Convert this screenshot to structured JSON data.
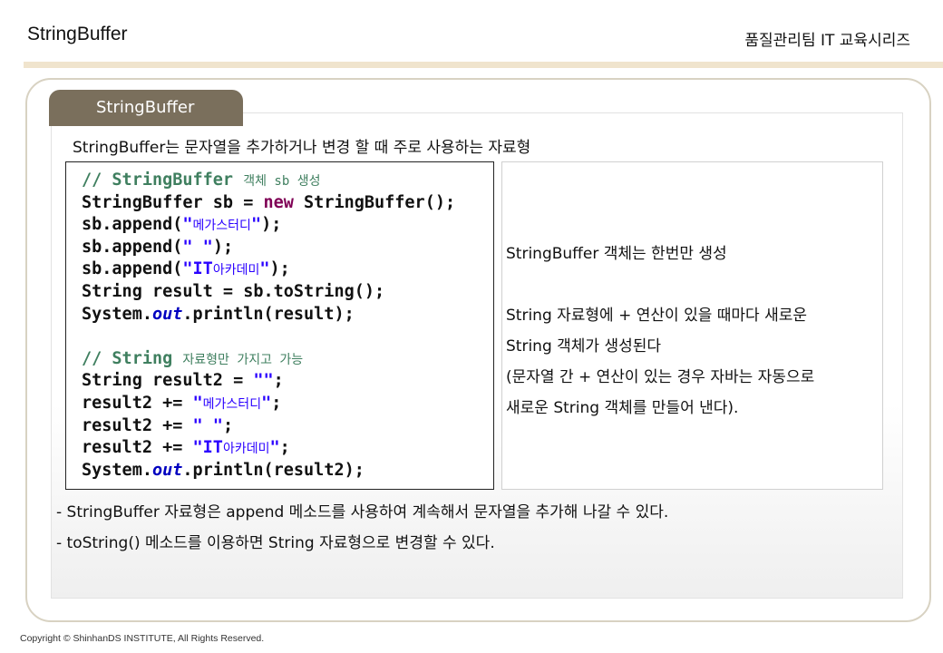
{
  "header": {
    "title": "StringBuffer",
    "series": "품질관리팀 IT 교육시리즈"
  },
  "section": {
    "tab_label": "StringBuffer",
    "intro": "StringBuffer는 문자열을 추가하거나 변경 할 때 주로 사용하는 자료형"
  },
  "code": {
    "comment1_en": "// StringBuffer ",
    "comment1_ko": "객체 sb 생성",
    "l2_type": "StringBuffer sb = ",
    "l2_kw": "new",
    "l2_rest": " StringBuffer();",
    "l3_pre": "sb.append(",
    "l3_q1": "\"",
    "l3_str": "메가스터디",
    "l3_q2": "\"",
    "l3_post": ");",
    "l4_pre": "sb.append(",
    "l4_str": "\" \"",
    "l4_post": ");",
    "l5_pre": "sb.append(",
    "l5_str_en": "\"IT",
    "l5_str_ko": "아카데미",
    "l5_q": "\"",
    "l5_post": ");",
    "l6": "String result = sb.toString();",
    "l7_pre": "System.",
    "l7_field": "out",
    "l7_post": ".println(result);",
    "comment2_en": "// String ",
    "comment2_ko": "자료형만 가지고 가능",
    "l9_pre": "String result2 = ",
    "l9_str": "\"\"",
    "l9_post": ";",
    "l10_pre": "result2 += ",
    "l10_q1": "\"",
    "l10_str": "메가스터디",
    "l10_q2": "\"",
    "l10_post": ";",
    "l11_pre": "result2 += ",
    "l11_str": "\" \"",
    "l11_post": ";",
    "l12_pre": "result2 += ",
    "l12_str_en": "\"IT",
    "l12_str_ko": "아카데미",
    "l12_q": "\"",
    "l12_post": ";",
    "l13_pre": "System.",
    "l13_field": "out",
    "l13_post": ".println(result2);"
  },
  "explain": {
    "line1": "StringBuffer 객체는 한번만 생성",
    "line2": "String 자료형에 + 연산이 있을 때마다 새로운",
    "line3": "String 객체가 생성된다",
    "line4": "(문자열 간 + 연산이 있는 경우 자바는 자동으로",
    "line5": "새로운 String 객체를 만들어 낸다)."
  },
  "bullets": [
    "- StringBuffer 자료형은 append 메소드를 사용하여 계속해서 문자열을 추가해 나갈 수 있다.",
    "- toString() 메소드를 이용하면 String 자료형으로 변경할 수 있다."
  ],
  "footer": {
    "copyright": "Copyright © ShinhanDS INSTITUTE, All Rights Reserved."
  }
}
